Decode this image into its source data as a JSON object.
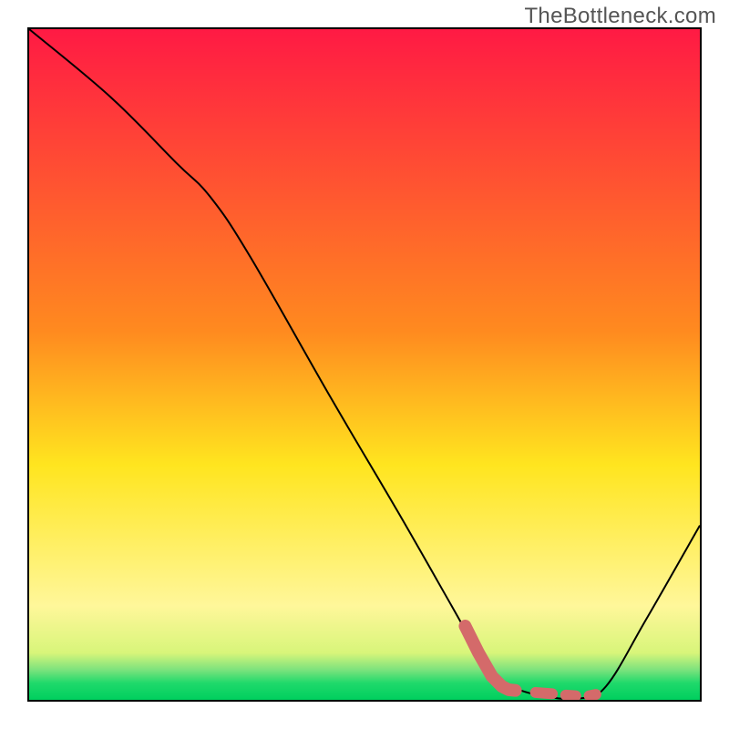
{
  "watermark": "TheBottleneck.com",
  "chart_data": {
    "type": "line",
    "title": "",
    "xlabel": "",
    "ylabel": "",
    "xlim": [
      0,
      100
    ],
    "ylim": [
      0,
      100
    ],
    "gradient_stops": [
      {
        "offset": 0.0,
        "color": "#ff1a44"
      },
      {
        "offset": 0.45,
        "color": "#ff8a1f"
      },
      {
        "offset": 0.65,
        "color": "#ffe51f"
      },
      {
        "offset": 0.86,
        "color": "#fff79a"
      },
      {
        "offset": 0.93,
        "color": "#d8f57a"
      },
      {
        "offset": 0.955,
        "color": "#7de37d"
      },
      {
        "offset": 0.975,
        "color": "#1fd96b"
      },
      {
        "offset": 1.0,
        "color": "#00cf5e"
      }
    ],
    "axes_ticks": [],
    "series": [
      {
        "name": "curve",
        "style": "thin-black",
        "points": [
          {
            "x": 0,
            "y": 100
          },
          {
            "x": 12,
            "y": 90
          },
          {
            "x": 22,
            "y": 80
          },
          {
            "x": 27,
            "y": 75
          },
          {
            "x": 33,
            "y": 66
          },
          {
            "x": 45,
            "y": 45
          },
          {
            "x": 55,
            "y": 28
          },
          {
            "x": 63,
            "y": 14
          },
          {
            "x": 67,
            "y": 7
          },
          {
            "x": 70,
            "y": 3
          },
          {
            "x": 73,
            "y": 1.5
          },
          {
            "x": 77,
            "y": 0.5
          },
          {
            "x": 82,
            "y": 0.2
          },
          {
            "x": 86,
            "y": 2
          },
          {
            "x": 92,
            "y": 12
          },
          {
            "x": 100,
            "y": 26
          }
        ]
      },
      {
        "name": "highlight",
        "style": "thick-red-dotted",
        "segments": [
          [
            {
              "x": 65,
              "y": 11
            },
            {
              "x": 67,
              "y": 7
            },
            {
              "x": 69,
              "y": 3.5
            },
            {
              "x": 70.5,
              "y": 2
            },
            {
              "x": 71.5,
              "y": 1.5
            },
            {
              "x": 72.5,
              "y": 1.4
            }
          ],
          [
            {
              "x": 75.5,
              "y": 1.1
            },
            {
              "x": 78,
              "y": 0.9
            }
          ],
          [
            {
              "x": 80,
              "y": 0.7
            },
            {
              "x": 81.5,
              "y": 0.6
            }
          ],
          [
            {
              "x": 83.5,
              "y": 0.6
            },
            {
              "x": 84.5,
              "y": 0.8
            }
          ]
        ]
      }
    ]
  }
}
